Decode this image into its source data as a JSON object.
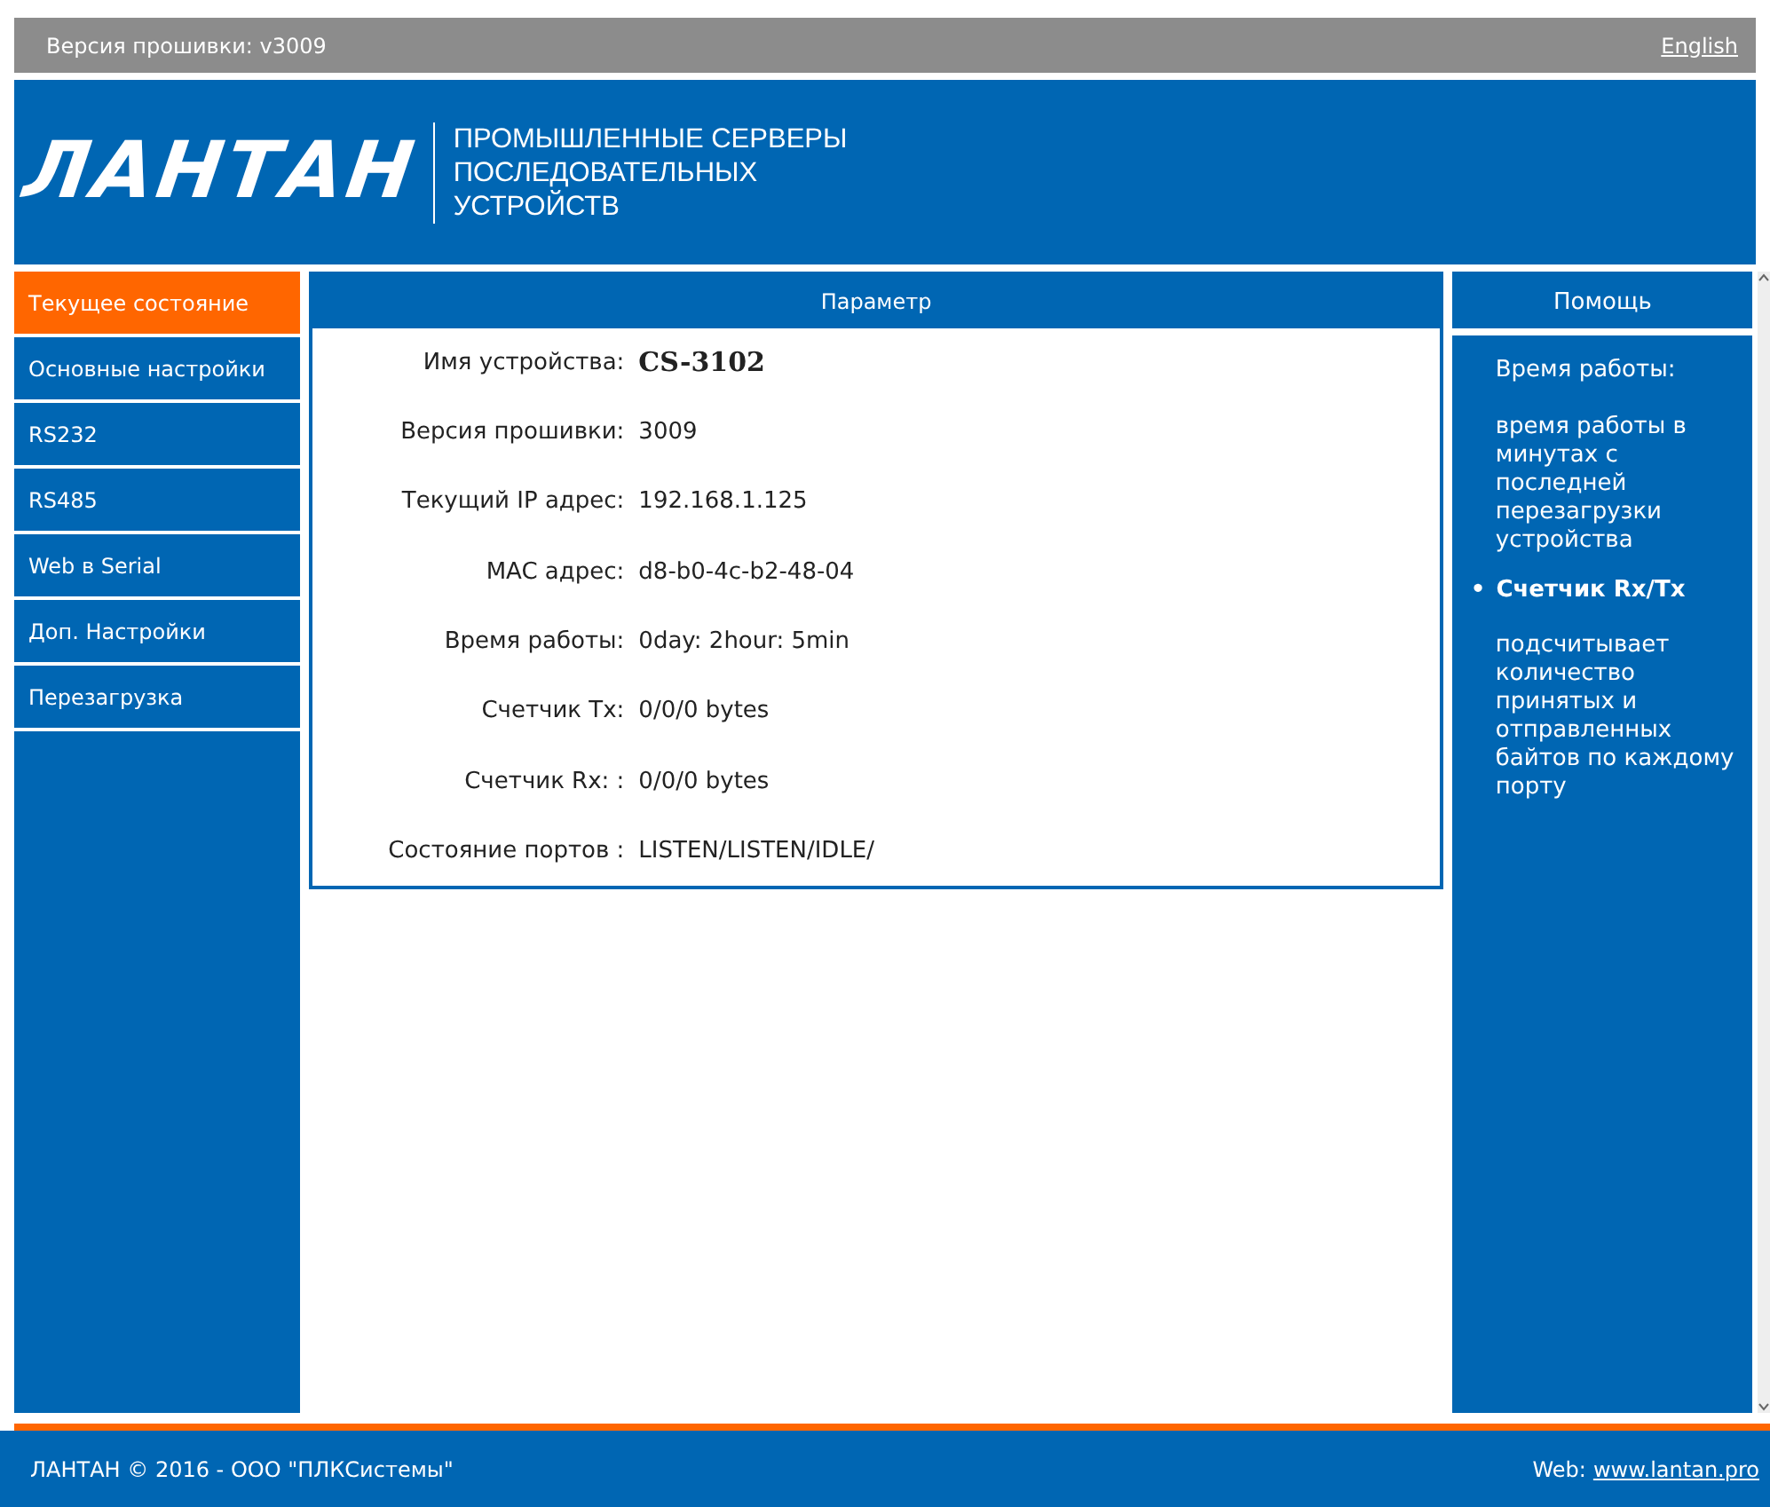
{
  "top_bar": {
    "firmware": "Версия прошивки: v3009",
    "language_link": "English"
  },
  "header": {
    "logo": "ЛАНТАН",
    "tagline": [
      "ПРОМЫШЛЕННЫЕ СЕРВЕРЫ",
      "ПОСЛЕДОВАТЕЛЬНЫХ",
      "УСТРОЙСТВ"
    ]
  },
  "sidebar": {
    "items": [
      {
        "label": "Текущее состояние",
        "selected": true
      },
      {
        "label": "Основные настройки",
        "selected": false
      },
      {
        "label": "RS232",
        "selected": false
      },
      {
        "label": "RS485",
        "selected": false
      },
      {
        "label": "Web в Serial",
        "selected": false
      },
      {
        "label": "Доп. Настройки",
        "selected": false
      },
      {
        "label": "Перезагрузка",
        "selected": false
      }
    ]
  },
  "parameters": {
    "title": "Параметр",
    "rows": [
      {
        "label": "Имя устройства:",
        "value": "CS-3102",
        "bold": true
      },
      {
        "label": "Версия прошивки:",
        "value": "3009",
        "bold": false
      },
      {
        "label": "Текущий IP адрес:",
        "value": "192.168.1.125",
        "bold": false
      },
      {
        "label": "MAC адрес:",
        "value": "d8-b0-4c-b2-48-04",
        "bold": false
      },
      {
        "label": "Время работы:",
        "value": "0day: 2hour: 5min",
        "bold": false
      },
      {
        "label": "Счетчик Tx:",
        "value": "0/0/0 bytes",
        "bold": false
      },
      {
        "label": "Счетчик Rx: :",
        "value": "0/0/0 bytes",
        "bold": false
      },
      {
        "label": "Состояние портов :",
        "value": "LISTEN/LISTEN/IDLE/",
        "bold": false
      }
    ]
  },
  "help": {
    "title": "Помощь",
    "entries": [
      {
        "kind": "plain",
        "term": "Время работы:",
        "text": "время работы в минутах с последней перезагрузки устройства"
      },
      {
        "kind": "bullet",
        "marker": "•",
        "term": "Счетчик Rx/Tx",
        "text": "подсчитывает количество принятых и отправленных байтов по каждому порту"
      }
    ]
  },
  "footer": {
    "copyright": "ЛАНТАН © 2016 - ООО \"ПЛКСистемы\"",
    "web_label": "Web:",
    "web_link": "www.lantan.pro"
  }
}
